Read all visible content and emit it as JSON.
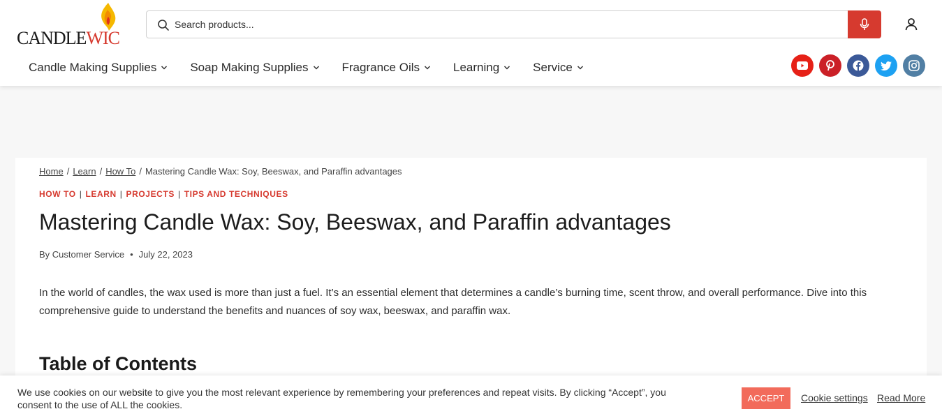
{
  "logo": {
    "text_dark": "CANDLE",
    "text_red": "WIC"
  },
  "search": {
    "placeholder": "Search products..."
  },
  "nav": [
    {
      "label": "Candle Making Supplies"
    },
    {
      "label": "Soap Making Supplies"
    },
    {
      "label": "Fragrance Oils"
    },
    {
      "label": "Learning"
    },
    {
      "label": "Service"
    }
  ],
  "social": [
    {
      "name": "youtube-icon",
      "color": "#e62117"
    },
    {
      "name": "pinterest-icon",
      "color": "#cb2027"
    },
    {
      "name": "facebook-icon",
      "color": "#3b5998"
    },
    {
      "name": "twitter-icon",
      "color": "#1da1f2"
    },
    {
      "name": "instagram-icon",
      "color": "#517fa4"
    }
  ],
  "breadcrumb": {
    "items": [
      "Home",
      "Learn",
      "How To"
    ],
    "separator": "/",
    "current": "Mastering Candle Wax: Soy, Beeswax, and Paraffin advantages"
  },
  "categories": [
    "HOW TO",
    "LEARN",
    "PROJECTS",
    "TIPS AND TECHNIQUES"
  ],
  "category_separator": "|",
  "article": {
    "title": "Mastering Candle Wax: Soy, Beeswax, and Paraffin advantages",
    "author": "By Customer Service",
    "date": "July 22, 2023",
    "intro": "In the world of candles, the wax used is more than just a fuel. It’s an essential element that determines a candle’s burning time, scent throw, and overall performance. Dive into this comprehensive guide to understand the benefits and nuances of soy wax, beeswax, and paraffin wax.",
    "toc_heading": "Table of Contents"
  },
  "cookie": {
    "text": "We use cookies on our website to give you the most relevant experience by remembering your preferences and repeat visits. By clicking “Accept”, you consent to the use of ALL the cookies.",
    "accept_label": "ACCEPT",
    "settings_label": "Cookie settings",
    "read_more_label": "Read More"
  },
  "colors": {
    "brand_red": "#d63a2f",
    "accept_bg": "#f26b5b"
  }
}
